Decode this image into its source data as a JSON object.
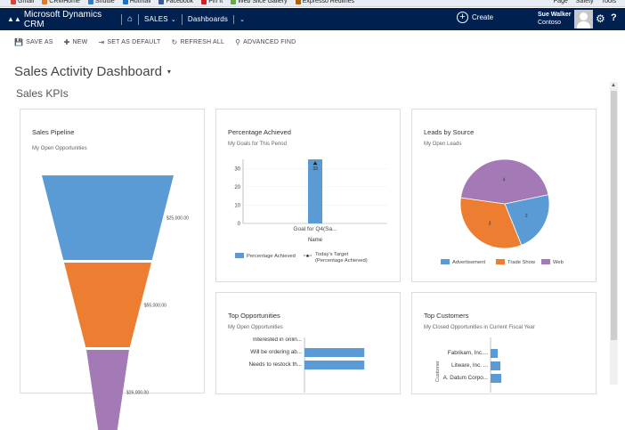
{
  "browser": {
    "bookmarks": [
      {
        "label": "Gmail",
        "color": "#d44638"
      },
      {
        "label": "CRMHome",
        "color": "#e07b1f"
      },
      {
        "label": "Shuttle",
        "color": "#3a7ac2"
      },
      {
        "label": "Hotmail",
        "color": "#1e6fc0"
      },
      {
        "label": "Facebook",
        "color": "#3b5998"
      },
      {
        "label": "Pin It",
        "color": "#cb2027"
      },
      {
        "label": "Web Slice Gallery",
        "color": "#6aa84f"
      },
      {
        "label": "Expresso Redlines",
        "color": "#b45f06"
      }
    ],
    "right_tools": [
      "Page",
      "Safety",
      "Tools"
    ]
  },
  "nav": {
    "app_name": "Microsoft Dynamics CRM",
    "area": "SALES",
    "subarea": "Dashboards",
    "create_label": "Create",
    "user_name": "Sue Walker",
    "org_name": "Contoso"
  },
  "commands": [
    {
      "icon": "save-icon",
      "glyph": "💾",
      "label": "SAVE AS"
    },
    {
      "icon": "new-icon",
      "glyph": "✚",
      "label": "NEW"
    },
    {
      "icon": "set-default-icon",
      "glyph": "⇥",
      "label": "SET AS DEFAULT"
    },
    {
      "icon": "refresh-icon",
      "glyph": "↻",
      "label": "REFRESH ALL"
    },
    {
      "icon": "advanced-find-icon",
      "glyph": "⚲",
      "label": "ADVANCED FIND"
    }
  ],
  "page": {
    "title": "Sales Activity Dashboard",
    "section": "Sales KPIs"
  },
  "cards": {
    "pipeline": {
      "title": "Sales Pipeline",
      "subtitle": "My Open Opportunities"
    },
    "percentage": {
      "title": "Percentage Achieved",
      "subtitle": "My Goals for This Period"
    },
    "leads": {
      "title": "Leads by Source",
      "subtitle": "My Open Leads"
    },
    "top_opps": {
      "title": "Top Opportunities",
      "subtitle": "My Open Opportunities"
    },
    "top_customers": {
      "title": "Top Customers",
      "subtitle": "My Closed Opportunities in Current Fiscal Year"
    }
  },
  "colors": {
    "blue": "#5b9bd5",
    "orange": "#ed7d31",
    "purple": "#a37ab5",
    "nav_bg": "#002050"
  },
  "chart_data": [
    {
      "type": "funnel",
      "title": "Sales Pipeline",
      "stages": [
        {
          "label": "$25,000.00",
          "value": 25000,
          "color": "#5b9bd5"
        },
        {
          "label": "$55,000.00",
          "value": 55000,
          "color": "#ed7d31"
        },
        {
          "label": "$26,000.00",
          "value": 26000,
          "color": "#a37ab5"
        }
      ]
    },
    {
      "type": "bar",
      "title": "Percentage Achieved",
      "categories": [
        "Goal for Q4(Sa..."
      ],
      "xlabel": "Name",
      "ylim": [
        0,
        35
      ],
      "yticks": [
        0,
        10,
        20,
        30
      ],
      "series": [
        {
          "name": "Percentage Achieved",
          "values": [
            35
          ],
          "color": "#5b9bd5"
        },
        {
          "name": "Today's Target (Percentage Achieved)",
          "values": [
            33
          ],
          "marker": "triangle"
        }
      ],
      "data_labels": [
        "33"
      ],
      "legend": "bottom"
    },
    {
      "type": "pie",
      "title": "Leads by Source",
      "slices": [
        {
          "name": "Advertisement",
          "value": 2,
          "color": "#5b9bd5"
        },
        {
          "name": "Trade Show",
          "value": 3,
          "color": "#ed7d31"
        },
        {
          "name": "Web",
          "value": 4,
          "color": "#a37ab5"
        }
      ],
      "legend": "bottom"
    },
    {
      "type": "bar",
      "orientation": "horizontal",
      "title": "Top Opportunities",
      "categories": [
        "Interested in onlin...",
        "Will be ordering ab...",
        "Needs to restock th..."
      ],
      "values": [
        0,
        28,
        28
      ],
      "color": "#5b9bd5"
    },
    {
      "type": "bar",
      "orientation": "horizontal",
      "title": "Top Customers",
      "ylabel": "Customer",
      "categories": [
        "Fabrikam, Inc....",
        "Litware, Inc. ...",
        "A. Datum Corpo..."
      ],
      "values": [
        8,
        11,
        12
      ],
      "color": "#5b9bd5"
    }
  ]
}
